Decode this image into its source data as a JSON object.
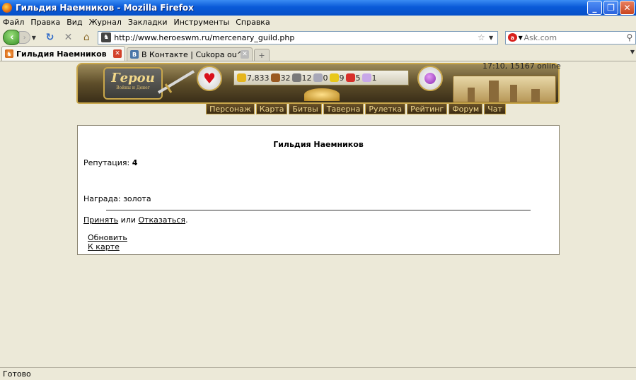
{
  "window": {
    "title": "Гильдия Наемников - Mozilla Firefox"
  },
  "menu": [
    "Файл",
    "Правка",
    "Вид",
    "Журнал",
    "Закладки",
    "Инструменты",
    "Справка"
  ],
  "nav": {
    "url": "http://www.heroeswm.ru/mercenary_guild.php",
    "search_placeholder": "Ask.com"
  },
  "tabs": [
    {
      "label": "Гильдия Наемников",
      "active": true
    },
    {
      "label": "В Контакте | Cukopa ou^ He...",
      "active": false
    }
  ],
  "game": {
    "logo_title": "Герои",
    "logo_subtitle": "Войны и Денег",
    "resources": [
      {
        "icon": "gold-icon",
        "value": "7,833"
      },
      {
        "icon": "wood-icon",
        "value": "32"
      },
      {
        "icon": "ore-icon",
        "value": "12"
      },
      {
        "icon": "mercury-icon",
        "value": "0"
      },
      {
        "icon": "sulfur-icon",
        "value": "9"
      },
      {
        "icon": "crystal-icon",
        "value": "5"
      },
      {
        "icon": "gem-icon",
        "value": "1"
      }
    ],
    "online": "17:10, 15167 online",
    "menu": [
      "Персонаж",
      "Карта",
      "Битвы",
      "Таверна",
      "Рулетка",
      "Рейтинг",
      "Форум",
      "Чат"
    ]
  },
  "panel": {
    "title": "Гильдия Наемников",
    "reputation_label": "Репутация:",
    "reputation_value": "4",
    "reward_label": "Награда:",
    "reward_value": "золота",
    "accept": "Принять",
    "or": "или",
    "decline": "Отказаться",
    "period": ".",
    "refresh": "Обновить",
    "to_map": "К карте"
  },
  "status": "Готово",
  "colors": {
    "titlebar": "#0a5ad8",
    "gold": "#c9a74b",
    "background": "#ece9d8"
  }
}
